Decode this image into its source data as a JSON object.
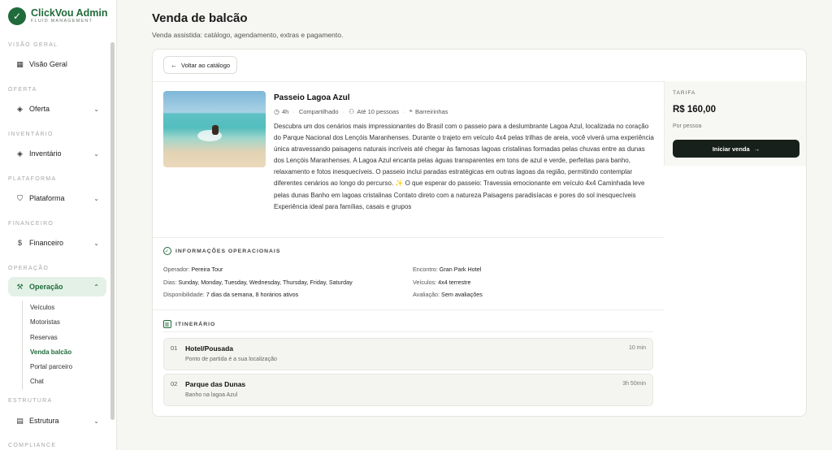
{
  "brand": {
    "name": "ClickVou Admin",
    "tagline": "FLUID MANAGEMENT"
  },
  "sidebar": {
    "sections": {
      "visao_geral": "VISÃO GERAL",
      "oferta": "OFERTA",
      "inventario": "INVENTÁRIO",
      "plataforma": "PLATAFORMA",
      "financeiro": "FINANCEIRO",
      "operacao": "OPERAÇÃO",
      "estrutura": "ESTRUTURA",
      "compliance": "COMPLIANCE"
    },
    "items": {
      "visao_geral": "Visão Geral",
      "oferta": "Oferta",
      "inventario": "Inventário",
      "plataforma": "Plataforma",
      "financeiro": "Financeiro",
      "operacao": "Operação",
      "estrutura": "Estrutura"
    },
    "operacao_sub": [
      "Veículos",
      "Motoristas",
      "Reservas",
      "Venda balcão",
      "Portal parceiro",
      "Chat"
    ],
    "active_sub": "Venda balcão"
  },
  "page": {
    "title": "Venda de balcão",
    "subtitle": "Venda assistida: catálogo, agendamento, extras e pagamento."
  },
  "back_button": "Voltar ao catálogo",
  "tour": {
    "title": "Passeio Lagoa Azul",
    "duration": "4h",
    "type": "Compartilhado",
    "capacity": "Até 10 pessoas",
    "location": "Barreirinhas",
    "description": "Descubra um dos cenários mais impressionantes do Brasil com o passeio para a deslumbrante Lagoa Azul, localizada no coração do Parque Nacional dos Lençóis Maranhenses. Durante o trajeto em veículo 4x4 pelas trilhas de areia, você viverá uma experiência única atravessando paisagens naturais incríveis até chegar às famosas lagoas cristalinas formadas pelas chuvas entre as dunas dos Lençóis Maranhenses. A Lagoa Azul encanta pelas águas transparentes em tons de azul e verde, perfeitas para banho, relaxamento e fotos inesquecíveis. O passeio inclui paradas estratégicas em outras lagoas da região, permitindo contemplar diferentes cenários ao longo do percurso. ✨ O que esperar do passeio: Travessia emocionante em veículo 4x4 Caminhada leve pelas dunas Banho em lagoas cristalinas Contato direto com a natureza Paisagens paradisíacas e pores do sol inesquecíveis Experiência ideal para famílias, casais e grupos"
  },
  "tariff": {
    "label": "TARIFA",
    "price": "R$ 160,00",
    "per": "Por pessoa",
    "button": "Iniciar venda"
  },
  "ops_info": {
    "heading": "INFORMAÇÕES OPERACIONAIS",
    "operator_label": "Operador:",
    "operator": "Pereira Tour",
    "days_label": "Dias:",
    "days": "Sunday, Monday, Tuesday, Wednesday, Thursday, Friday, Saturday",
    "availability_label": "Disponibilidade:",
    "availability": "7 dias da semana, 8 horários ativos",
    "meeting_label": "Encontro:",
    "meeting": "Gran Park Hotel",
    "vehicles_label": "Veículos:",
    "vehicles": "4x4 terrestre",
    "rating_label": "Avaliação:",
    "rating": "Sem avaliações"
  },
  "itinerary": {
    "heading": "ITINERÁRIO",
    "stops": [
      {
        "num": "01",
        "name": "Hotel/Pousada",
        "note": "Ponto de partida é a sua localização",
        "duration": "10 min"
      },
      {
        "num": "02",
        "name": "Parque das Dunas",
        "note": "Banho na lagoa Azul",
        "duration": "3h 50min"
      }
    ]
  }
}
